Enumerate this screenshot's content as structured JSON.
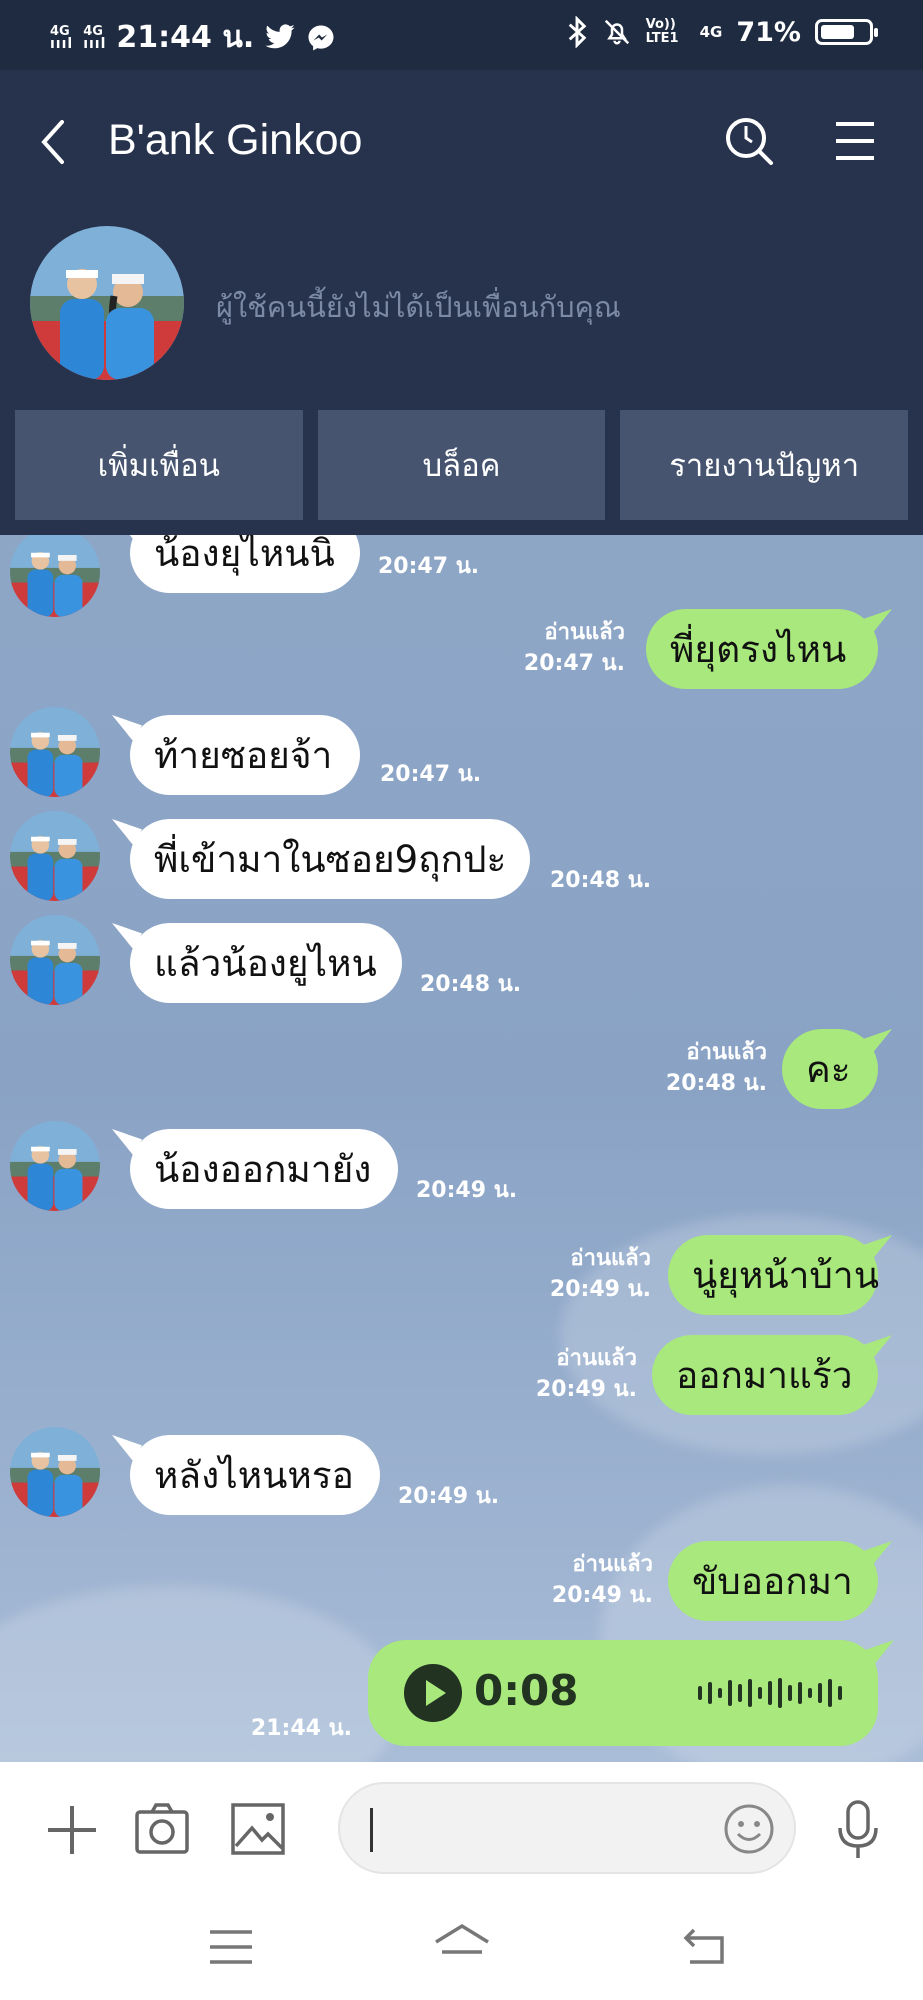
{
  "status_bar": {
    "network1": "4G",
    "network2": "4G",
    "time": "21:44 น.",
    "volte": "Vo)) LTE1",
    "net3": "4G",
    "battery_pct": "71%",
    "battery_level": 0.71
  },
  "header": {
    "title": "B'ank Ginkoo",
    "notice": "ผู้ใช้คนนี้ยังไม่ได้เป็นเพื่อนกับคุณ",
    "actions": [
      "เพิ่มเพื่อน",
      "บล็อค",
      "รายงานปัญหา"
    ]
  },
  "messages": [
    {
      "dir": "in",
      "text": "น้องยุไหนนิ",
      "time": ""
    },
    {
      "dir": "out",
      "text": "พี่ยุตรงไหน",
      "read": "อ่านแล้ว",
      "time": "20:47 น."
    },
    {
      "dir": "in",
      "text": "ท้ายซอยจ้า",
      "time": "20:47 น."
    },
    {
      "dir": "in",
      "text": "พี่เข้ามาในซอย9ถุกปะ",
      "time": "20:48 น."
    },
    {
      "dir": "in",
      "text": "แล้วน้องยูไหน",
      "time": "20:48 น."
    },
    {
      "dir": "out",
      "text": "คะ",
      "read": "อ่านแล้ว",
      "time": "20:48 น."
    },
    {
      "dir": "in",
      "text": "น้องออกมายัง",
      "time": "20:49 น."
    },
    {
      "dir": "out",
      "text": "นู่ยุหน้าบ้าน",
      "read": "อ่านแล้ว",
      "time": "20:49 น."
    },
    {
      "dir": "out",
      "text": "ออกมาแร้ว",
      "read": "อ่านแล้ว",
      "time": "20:49 น."
    },
    {
      "dir": "in",
      "text": "หลังไหนหรอ",
      "time": "20:49 น."
    },
    {
      "dir": "out",
      "text": "ขับออกมา",
      "read": "อ่านแล้ว",
      "time": "20:49 น."
    }
  ],
  "first_time": "20:47 น.",
  "voice": {
    "duration": "0:08",
    "time": "21:44 น."
  }
}
